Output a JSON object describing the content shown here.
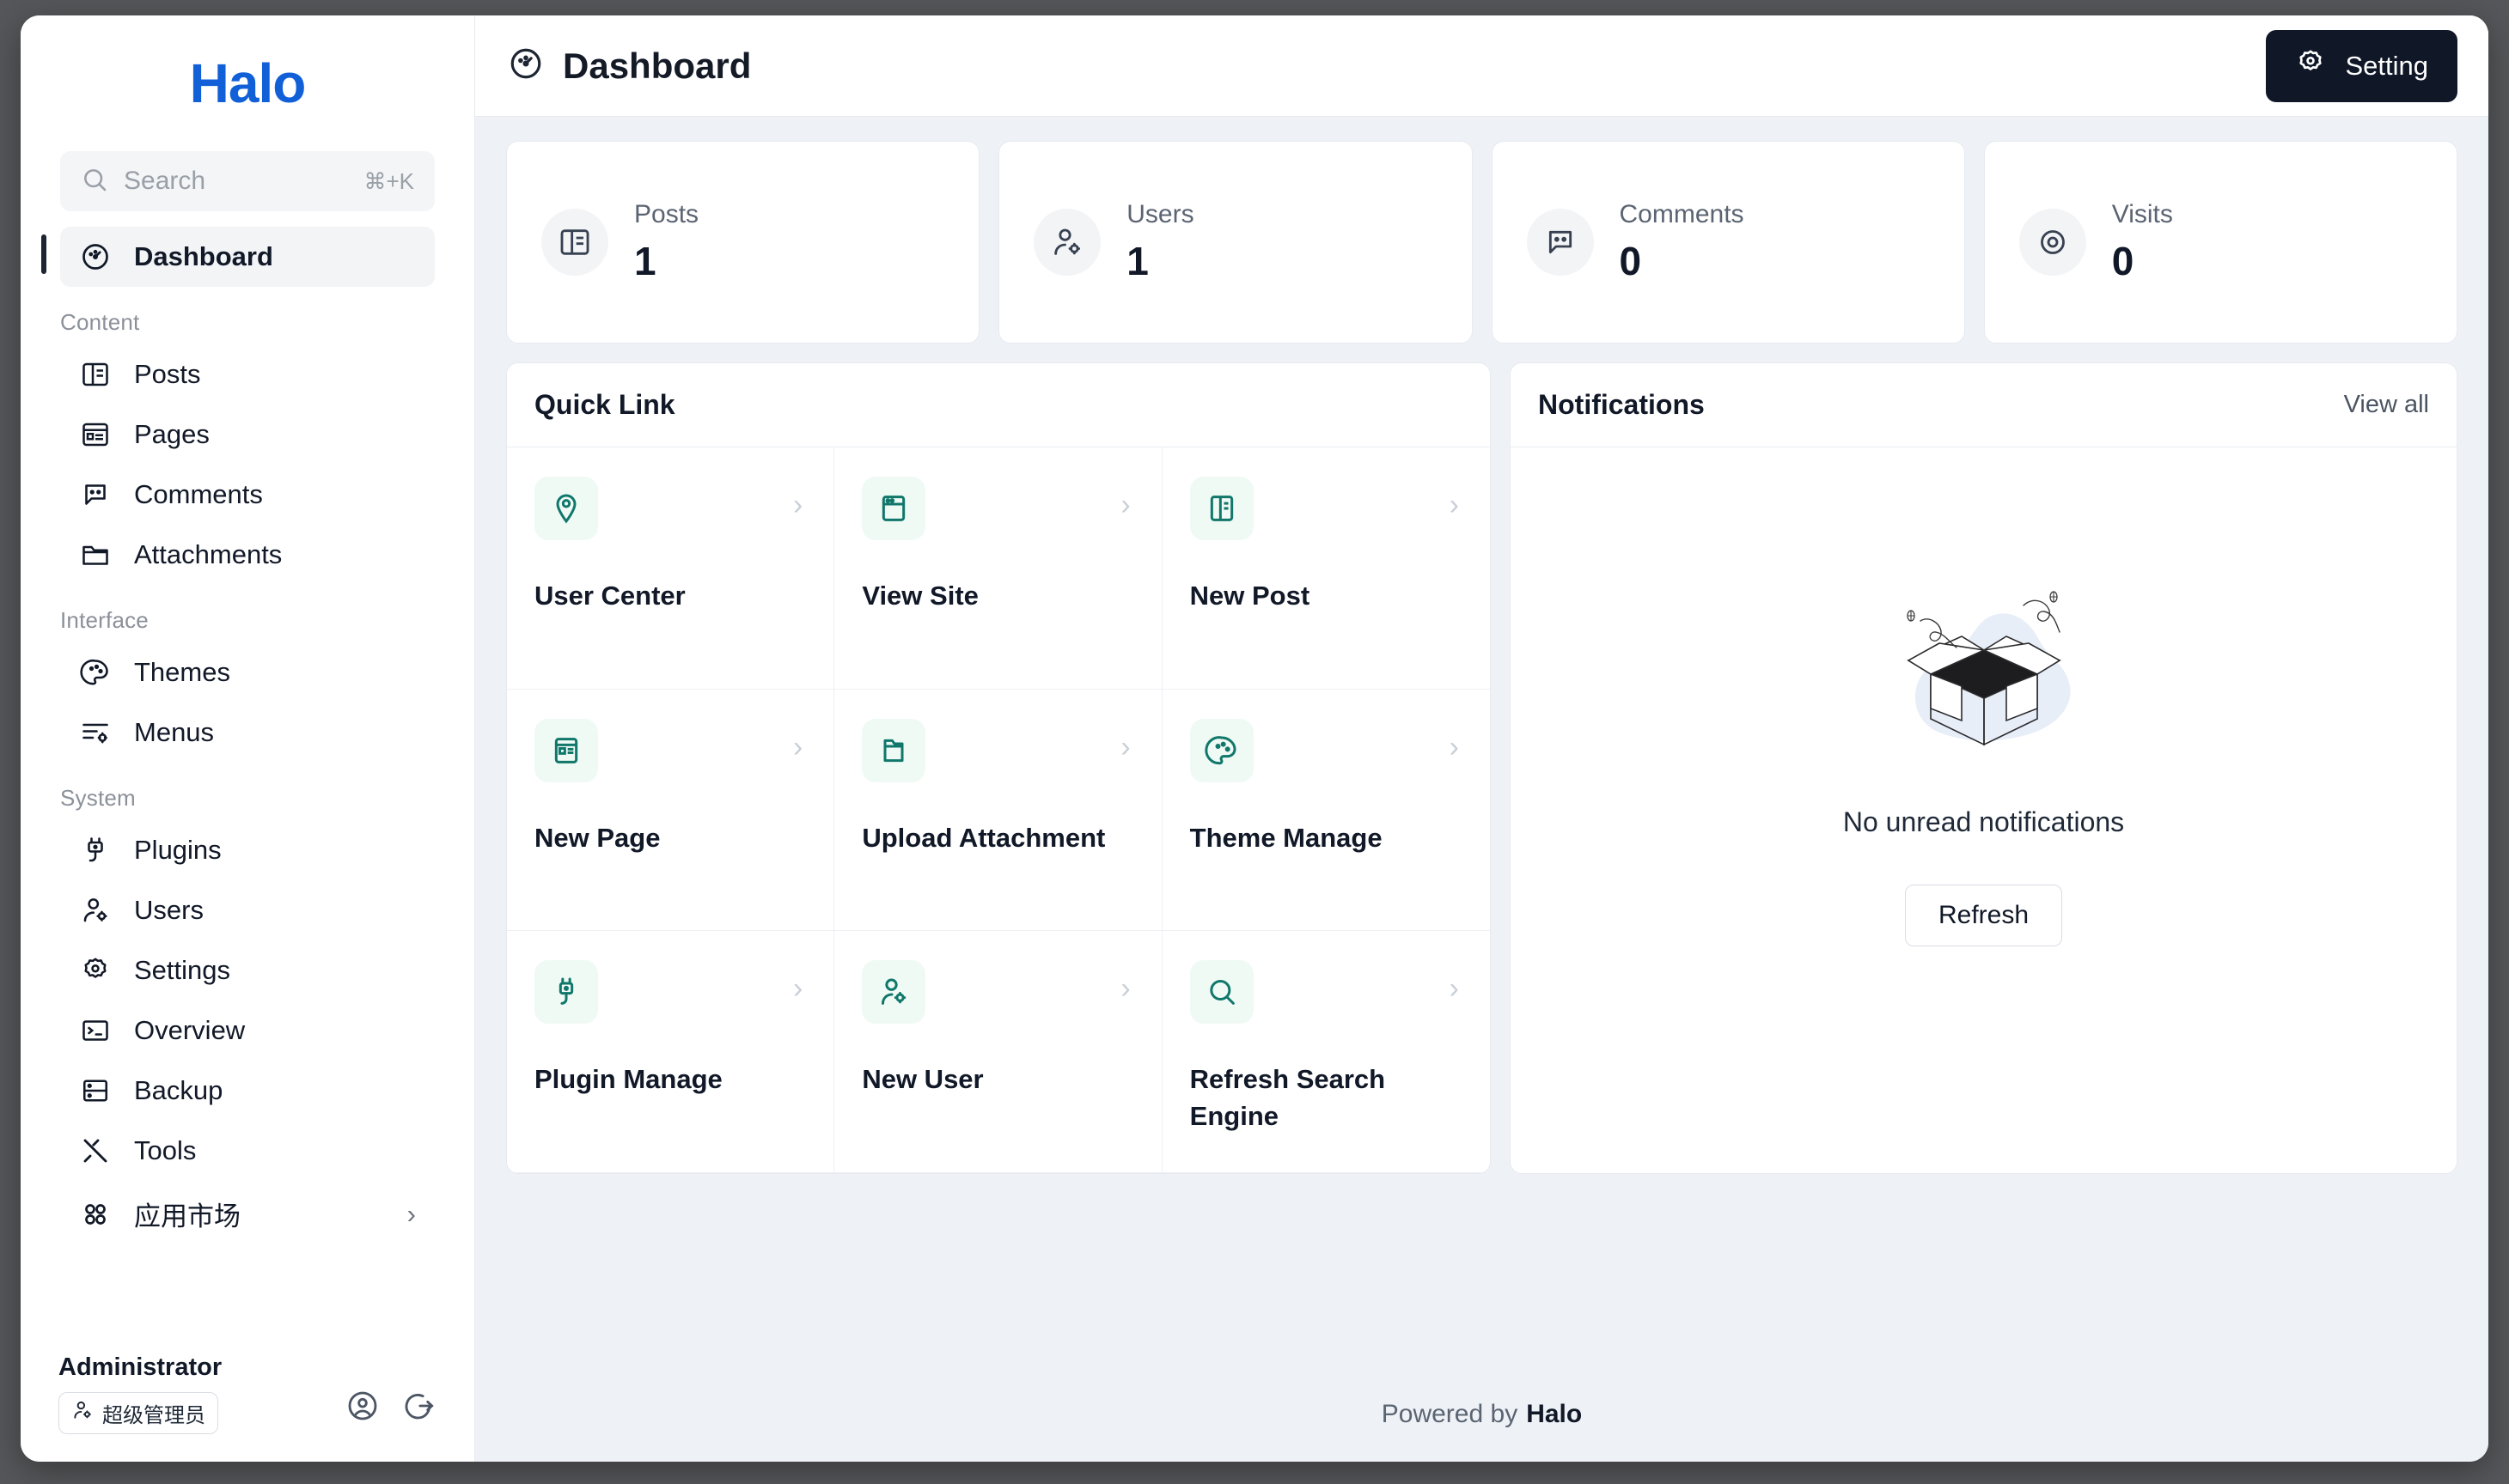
{
  "brand": {
    "logo_text": "Halo",
    "logo_color": "#1160d8"
  },
  "sidebar": {
    "search": {
      "placeholder": "Search",
      "shortcut": "⌘+K",
      "icon": "search-icon"
    },
    "primary": [
      {
        "label": "Dashboard",
        "icon": "dashboard-gauge-icon",
        "active": true
      }
    ],
    "sections": [
      {
        "label": "Content",
        "items": [
          {
            "label": "Posts",
            "icon": "posts-layout-icon"
          },
          {
            "label": "Pages",
            "icon": "pages-article-icon"
          },
          {
            "label": "Comments",
            "icon": "comment-bubble-icon"
          },
          {
            "label": "Attachments",
            "icon": "folder-icon"
          }
        ]
      },
      {
        "label": "Interface",
        "items": [
          {
            "label": "Themes",
            "icon": "palette-icon"
          },
          {
            "label": "Menus",
            "icon": "menu-settings-icon"
          }
        ]
      },
      {
        "label": "System",
        "items": [
          {
            "label": "Plugins",
            "icon": "plug-icon"
          },
          {
            "label": "Users",
            "icon": "user-settings-icon"
          },
          {
            "label": "Settings",
            "icon": "gear-icon"
          },
          {
            "label": "Overview",
            "icon": "terminal-icon"
          },
          {
            "label": "Backup",
            "icon": "backup-database-icon"
          },
          {
            "label": "Tools",
            "icon": "tools-icon"
          },
          {
            "label": "应用市场",
            "icon": "grid-apps-icon",
            "chevron": "›"
          }
        ]
      }
    ],
    "footer": {
      "user_name": "Administrator",
      "role_badge": "超级管理员",
      "role_icon": "user-settings-icon",
      "profile_icon": "user-circle-icon",
      "logout_icon": "logout-icon"
    }
  },
  "topbar": {
    "icon": "dashboard-gauge-icon",
    "title": "Dashboard",
    "setting_label": "Setting",
    "setting_icon": "gear-icon",
    "setting_bg": "#101828"
  },
  "stats": [
    {
      "label": "Posts",
      "value": "1",
      "icon": "posts-layout-icon"
    },
    {
      "label": "Users",
      "value": "1",
      "icon": "user-settings-icon"
    },
    {
      "label": "Comments",
      "value": "0",
      "icon": "comment-bubble-icon"
    },
    {
      "label": "Visits",
      "value": "0",
      "icon": "eye-icon"
    }
  ],
  "quick_link": {
    "title": "Quick Link",
    "arrow": "›",
    "items": [
      {
        "label": "User Center",
        "icon": "user-pin-icon"
      },
      {
        "label": "View Site",
        "icon": "browser-window-icon"
      },
      {
        "label": "New Post",
        "icon": "posts-layout-icon"
      },
      {
        "label": "New Page",
        "icon": "pages-article-icon"
      },
      {
        "label": "Upload Attachment",
        "icon": "folder-icon"
      },
      {
        "label": "Theme Manage",
        "icon": "palette-icon"
      },
      {
        "label": "Plugin Manage",
        "icon": "plug-icon"
      },
      {
        "label": "New User",
        "icon": "user-settings-icon"
      },
      {
        "label": "Refresh Search Engine",
        "icon": "search-icon"
      }
    ],
    "accent": "#10776a",
    "icon_bg": "#effaf5"
  },
  "notifications": {
    "title": "Notifications",
    "view_all": "View all",
    "empty_text": "No unread notifications",
    "refresh_label": "Refresh",
    "illustration": "empty-box-illustration"
  },
  "footer": {
    "powered_prefix": "Powered by",
    "powered_brand": "Halo"
  }
}
